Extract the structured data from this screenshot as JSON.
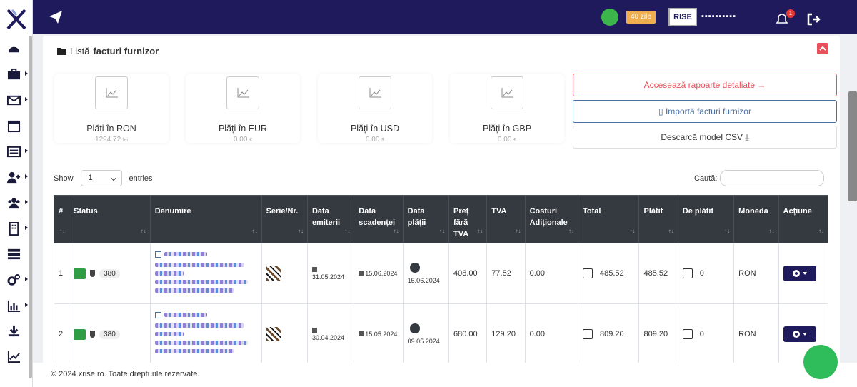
{
  "brand": {
    "accent": "#1e1a5c"
  },
  "topbar": {
    "days_badge": "40 zile",
    "company_logo_text": "RISE",
    "user_name": "▪▪▪▪▪▪▪▪▪▪",
    "notifications": "1"
  },
  "card": {
    "title_prefix": "Listă",
    "title_bold": "facturi furnizor"
  },
  "stats": [
    {
      "label": "Plăți în RON",
      "value": "1294.72",
      "unit": "lei"
    },
    {
      "label": "Plăți în EUR",
      "value": "0.00",
      "unit": "€"
    },
    {
      "label": "Plăți în USD",
      "value": "0.00",
      "unit": "$"
    },
    {
      "label": "Plăți în GBP",
      "value": "0.00",
      "unit": "£"
    }
  ],
  "actions": {
    "reports": "Accesează rapoarte detaliate →",
    "import": "Importă facturi furnizor",
    "download": "Descarcă model CSV"
  },
  "table_controls": {
    "show": "Show",
    "entries_value": "1",
    "entries": "entries",
    "search": "Caută:"
  },
  "columns": [
    "#",
    "Status",
    "Denumire",
    "Serie/Nr.",
    "Data emiterii",
    "Data scadenței",
    "Data plății",
    "Preț fără TVA",
    "TVA",
    "Costuri Adiționale",
    "Total",
    "Plătit",
    "De plătit",
    "Moneda",
    "Acțiune"
  ],
  "rows": [
    {
      "num": "1",
      "status_count": "380",
      "issue_date": "31.05.2024",
      "due_date": "15.06.2024",
      "pay_date": "15.06.2024",
      "net": "408.00",
      "vat": "77.52",
      "extra": "0.00",
      "total": "485.52",
      "paid": "485.52",
      "due": "0",
      "currency": "RON"
    },
    {
      "num": "2",
      "status_count": "380",
      "issue_date": "30.04.2024",
      "due_date": "15.05.2024",
      "pay_date": "09.05.2024",
      "net": "680.00",
      "vat": "129.20",
      "extra": "0.00",
      "total": "809.20",
      "paid": "809.20",
      "due": "0",
      "currency": "RON"
    }
  ],
  "footer": {
    "text": "© 2024 xrise.ro. Toate drepturile rezervate."
  }
}
